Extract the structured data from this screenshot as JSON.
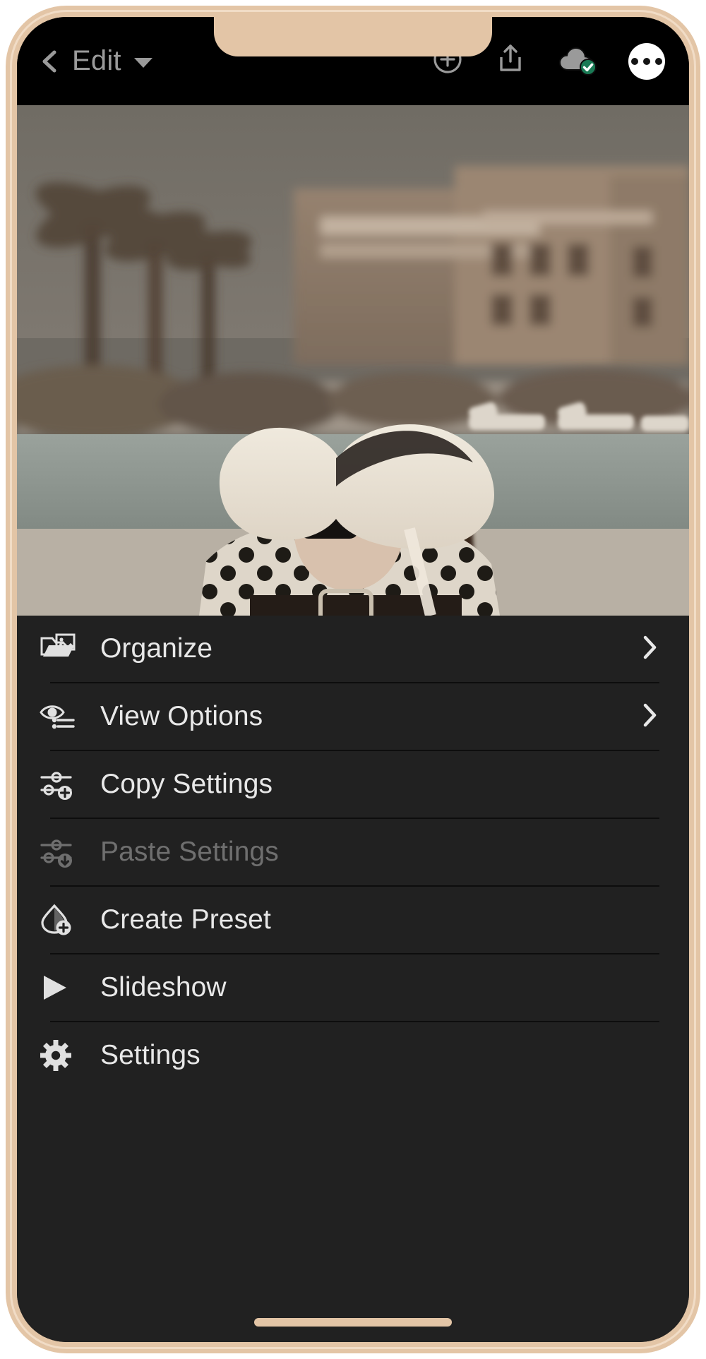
{
  "device": {
    "frame_color": "#e3c5a6",
    "screen_bg": "#000000"
  },
  "topbar": {
    "back_icon": "chevron-left-icon",
    "title": "Edit",
    "title_caret_icon": "caret-down-icon",
    "title_color": "#9a9a9a",
    "icons": [
      {
        "name": "add-photo-icon",
        "label": "Add"
      },
      {
        "name": "share-icon",
        "label": "Share"
      },
      {
        "name": "cloud-synced-icon",
        "label": "Synced",
        "badge_color": "#1a7a55"
      },
      {
        "name": "more-options-icon",
        "label": "More"
      }
    ]
  },
  "photo": {
    "alt": "Woman in wide-brim sun hat and polka-dot blouse by a hotel pool",
    "palette": {
      "sky": "#6f6b64",
      "building": "#8a7a6c",
      "pool": "#8e9690",
      "deck": "#b6aea3",
      "hat": "#e6ded2",
      "hair": "#3a2a21",
      "blouse": "#ded6c9",
      "dots": "#17130f"
    }
  },
  "menu": {
    "background": "#212121",
    "items": [
      {
        "label": "Organize",
        "icon": "folder-image-icon",
        "chevron": true,
        "disabled": false
      },
      {
        "label": "View Options",
        "icon": "eye-options-icon",
        "chevron": true,
        "disabled": false
      },
      {
        "label": "Copy Settings",
        "icon": "sliders-plus-icon",
        "chevron": false,
        "disabled": false
      },
      {
        "label": "Paste Settings",
        "icon": "sliders-down-icon",
        "chevron": false,
        "disabled": true
      },
      {
        "label": "Create Preset",
        "icon": "preset-plus-icon",
        "chevron": false,
        "disabled": false
      },
      {
        "label": "Slideshow",
        "icon": "play-icon",
        "chevron": false,
        "disabled": false
      },
      {
        "label": "Settings",
        "icon": "gear-icon",
        "chevron": false,
        "disabled": false
      }
    ]
  },
  "home_indicator": {
    "color": "#e3c5a6"
  }
}
